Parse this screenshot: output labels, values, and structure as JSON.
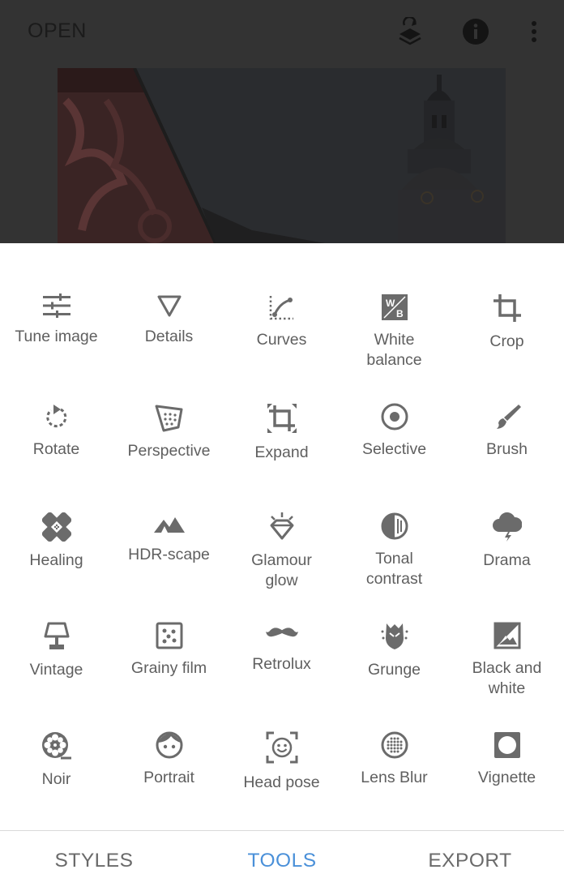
{
  "header": {
    "open_label": "OPEN",
    "icons": [
      "undo-layers-icon",
      "info-icon",
      "more-vert-icon"
    ]
  },
  "tools": [
    {
      "label": "Tune image",
      "icon": "tune-image-icon"
    },
    {
      "label": "Details",
      "icon": "details-icon"
    },
    {
      "label": "Curves",
      "icon": "curves-icon"
    },
    {
      "label": "White\nbalance",
      "icon": "white-balance-icon"
    },
    {
      "label": "Crop",
      "icon": "crop-icon"
    },
    {
      "label": "Rotate",
      "icon": "rotate-icon"
    },
    {
      "label": "Perspective",
      "icon": "perspective-icon"
    },
    {
      "label": "Expand",
      "icon": "expand-icon"
    },
    {
      "label": "Selective",
      "icon": "selective-icon"
    },
    {
      "label": "Brush",
      "icon": "brush-icon"
    },
    {
      "label": "Healing",
      "icon": "healing-icon"
    },
    {
      "label": "HDR-scape",
      "icon": "hdr-scape-icon"
    },
    {
      "label": "Glamour\nglow",
      "icon": "glamour-glow-icon"
    },
    {
      "label": "Tonal\ncontrast",
      "icon": "tonal-contrast-icon"
    },
    {
      "label": "Drama",
      "icon": "drama-icon"
    },
    {
      "label": "Vintage",
      "icon": "vintage-icon"
    },
    {
      "label": "Grainy film",
      "icon": "grainy-film-icon"
    },
    {
      "label": "Retrolux",
      "icon": "retrolux-icon"
    },
    {
      "label": "Grunge",
      "icon": "grunge-icon"
    },
    {
      "label": "Black and\nwhite",
      "icon": "black-and-white-icon"
    },
    {
      "label": "Noir",
      "icon": "noir-icon"
    },
    {
      "label": "Portrait",
      "icon": "portrait-icon"
    },
    {
      "label": "Head pose",
      "icon": "head-pose-icon"
    },
    {
      "label": "Lens Blur",
      "icon": "lens-blur-icon"
    },
    {
      "label": "Vignette",
      "icon": "vignette-icon"
    }
  ],
  "nav": {
    "styles_label": "STYLES",
    "tools_label": "TOOLS",
    "export_label": "EXPORT",
    "active": "TOOLS"
  },
  "colors": {
    "accent": "#4a90d9",
    "icon": "#6b6b6b",
    "label": "#5f5f5f",
    "overlay": "#333333"
  }
}
